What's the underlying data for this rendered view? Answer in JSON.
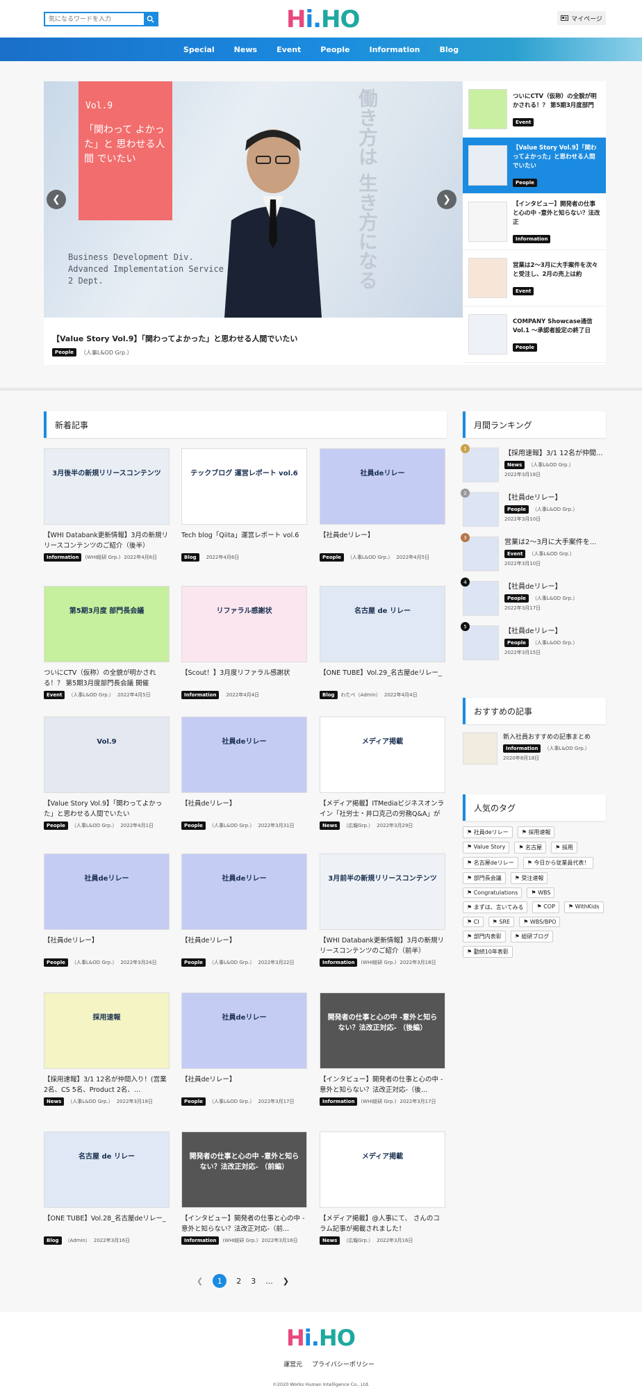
{
  "search": {
    "placeholder": "気になるワードを入力"
  },
  "logo": {
    "h": "H",
    "i": "i",
    "dot": ".",
    "ho": "HO"
  },
  "mypage": "マイページ",
  "nav": [
    "Special",
    "News",
    "Event",
    "People",
    "Information",
    "Blog"
  ],
  "hero": {
    "vol": "Vol.9",
    "quote": "「関わって よかった」と 思わせる人間 でいたい",
    "bgtext": "働き方は 生き方になる",
    "division": "Business Development Div. Advanced Implementation Service 2 Dept.",
    "caption": "【Value Story Vol.9】「関わってよかった」と思わせる人間でいたい",
    "tag": "People",
    "author": "（人事L&OD Grp.）"
  },
  "side": [
    {
      "title": "ついにCTV（仮称）の全貌が明かされる！？ 第5期3月度部門",
      "tag": "Event"
    },
    {
      "title": "【Value Story Vol.9】「関わってよかった」と思わせる人間でいたい",
      "tag": "People"
    },
    {
      "title": "【インタビュー】開発者の仕事と心の中 -意外と知らない？法改正",
      "tag": "Information"
    },
    {
      "title": "営業は2～3月に大手案件を次々と受注し、2月の売上は約",
      "tag": "Event"
    },
    {
      "title": "COMPANY Showcase通信 Vol.1 ～承認者設定の終了日",
      "tag": "People"
    }
  ],
  "sections": {
    "latest": "新着記事",
    "ranking": "月間ランキング",
    "recommend": "おすすめの記事",
    "tags": "人気のタグ"
  },
  "cards": [
    {
      "title": "【WHI Databank更新情報】3月の新規リリースコンテンツのご紹介（後半）",
      "tag": "Information",
      "author": "(WHI総研 Grp.)",
      "date": "2022年4月6日",
      "thumb": "3月後半の新規リリースコンテンツ",
      "bg": "#e8eef4"
    },
    {
      "title": "Tech blog「Qiita」運営レポート vol.6",
      "tag": "Blog",
      "author": "",
      "date": "2022年4月6日",
      "thumb": "テックブログ 運営レポート vol.6",
      "bg": "#ffffff"
    },
    {
      "title": "【社員deリレー】",
      "tag": "People",
      "author": "（人事L&OD Grp.）",
      "date": "2022年4月5日",
      "thumb": "社員deリレー",
      "bg": "#c4ccf4"
    },
    {
      "title": "ついにCTV（仮称）の全貌が明かされる！？ 第5期3月度部門長会議 開催",
      "tag": "Event",
      "author": "（人事L&OD Grp.）",
      "date": "2022年4月5日",
      "thumb": "第5期3月度 部門長会議",
      "bg": "#c6ef9e"
    },
    {
      "title": "【Scout！】3月度リファラル感謝状",
      "tag": "Information",
      "author": "",
      "date": "2022年4月4日",
      "thumb": "リファラル感謝状",
      "bg": "#fbe6f0"
    },
    {
      "title": "【ONE TUBE】Vol.29_名古屋deリレー_",
      "tag": "Blog",
      "author": "わたべ（Admin）",
      "date": "2022年4月4日",
      "thumb": "名古屋 de リレー",
      "bg": "#dfe8f4"
    },
    {
      "title": "【Value Story Vol.9】「関わってよかった」と思わせる人間でいたい",
      "tag": "People",
      "author": "（人事L&OD Grp.）",
      "date": "2022年4月1日",
      "thumb": "Vol.9",
      "bg": "#e4e8f0"
    },
    {
      "title": "【社員deリレー】",
      "tag": "People",
      "author": "（人事L&OD Grp.）",
      "date": "2022年3月31日",
      "thumb": "社員deリレー",
      "bg": "#c4ccf4"
    },
    {
      "title": "【メディア掲載】ITMediaビジネスオンライン「社労士・井口克己の労務Q&A」が更...",
      "tag": "News",
      "author": "（広報Grp.）",
      "date": "2022年3月29日",
      "thumb": "メディア掲載",
      "bg": "#ffffff"
    },
    {
      "title": "【社員deリレー】",
      "tag": "People",
      "author": "（人事L&OD Grp.）",
      "date": "2022年3月24日",
      "thumb": "社員deリレー",
      "bg": "#c4ccf4"
    },
    {
      "title": "【社員deリレー】",
      "tag": "People",
      "author": "（人事L&OD Grp.）",
      "date": "2022年3月22日",
      "thumb": "社員deリレー",
      "bg": "#c4ccf4"
    },
    {
      "title": "【WHI Databank更新情報】3月の新規リリースコンテンツのご紹介（前半）",
      "tag": "Information",
      "author": "(WHI総研 Grp.)",
      "date": "2022年3月18日",
      "thumb": "3月前半の新規リリースコンテンツ",
      "bg": "#eef2f6"
    },
    {
      "title": "【採用速報】3/1 12名が仲間入り！(営業 2名、CS 5名、Product 2名、...",
      "tag": "News",
      "author": "（人事L&OD Grp.）",
      "date": "2022年3月18日",
      "thumb": "採用速報",
      "bg": "#f4f4c4"
    },
    {
      "title": "【社員deリレー】",
      "tag": "People",
      "author": "（人事L&OD Grp.）",
      "date": "2022年3月17日",
      "thumb": "社員deリレー",
      "bg": "#c4ccf4"
    },
    {
      "title": "【インタビュー】開発者の仕事と心の中 -意外と知らない？法改正対応-（後...",
      "tag": "Information",
      "author": "(WHI総研 Grp.)",
      "date": "2022年3月17日",
      "thumb": "開発者の仕事と心の中 -意外と知らない？法改正対応- （後編）",
      "bg": "#555555"
    },
    {
      "title": "【ONE TUBE】Vol.28_名古屋deリレー_",
      "tag": "Blog",
      "author": "（Admin）",
      "date": "2022年3月16日",
      "thumb": "名古屋 de リレー",
      "bg": "#dfe8f4"
    },
    {
      "title": "【インタビュー】開発者の仕事と心の中 -意外と知らない？法改正対応-（前...",
      "tag": "Information",
      "author": "(WHI総研 Grp.)",
      "date": "2022年3月16日",
      "thumb": "開発者の仕事と心の中 -意外と知らない？法改正対応- （前編）",
      "bg": "#555555"
    },
    {
      "title": "【メディア掲載】@人事にて、 さんのコラム記事が掲載されました！",
      "tag": "News",
      "author": "（広報Grp.）",
      "date": "2022年3月16日",
      "thumb": "メディア掲載",
      "bg": "#ffffff"
    }
  ],
  "ranking": [
    {
      "n": "1",
      "title": "【採用速報】3/1 12名が仲間...",
      "tag": "News",
      "author": "（人事L&OD Grp.）",
      "date": "2022年3月18日"
    },
    {
      "n": "2",
      "title": "【社員deリレー】",
      "tag": "People",
      "author": "（人事L&OD Grp.）",
      "date": "2022年3月10日"
    },
    {
      "n": "3",
      "title": "営業は2～3月に大手案件を...",
      "tag": "Event",
      "author": "（人事L&OD Grp.）",
      "date": "2022年3月10日"
    },
    {
      "n": "4",
      "title": "【社員deリレー】",
      "tag": "People",
      "author": "（人事L&OD Grp.）",
      "date": "2022年3月17日"
    },
    {
      "n": "5",
      "title": "【社員deリレー】",
      "tag": "People",
      "author": "（人事L&OD Grp.）",
      "date": "2022年3月15日"
    }
  ],
  "recommend": {
    "title": "新入社員おすすめの記事まとめ",
    "tag": "Information",
    "author": "（人事L&OD Grp.）",
    "date": "2020年8月18日"
  },
  "tags": [
    "社員deリレー",
    "採用速報",
    "Value Story",
    "名古屋",
    "採用",
    "名古屋deリレー",
    "今日から従業員代表！",
    "部門長会議",
    "受注速報",
    "Congratulations",
    "WBS",
    "まずは、言いてみる",
    "COP",
    "WithKids",
    "CI",
    "SRE",
    "WBS/BPO",
    "部門内表彰",
    "総研ブログ",
    "勤続10年表彰"
  ],
  "pager": {
    "p1": "1",
    "p2": "2",
    "p3": "3",
    "dots": "..."
  },
  "footer": {
    "link1": "運営元",
    "link2": "プライバシーポリシー",
    "copyright": "©2020 Works Human Intelligence Co., Ltd."
  }
}
